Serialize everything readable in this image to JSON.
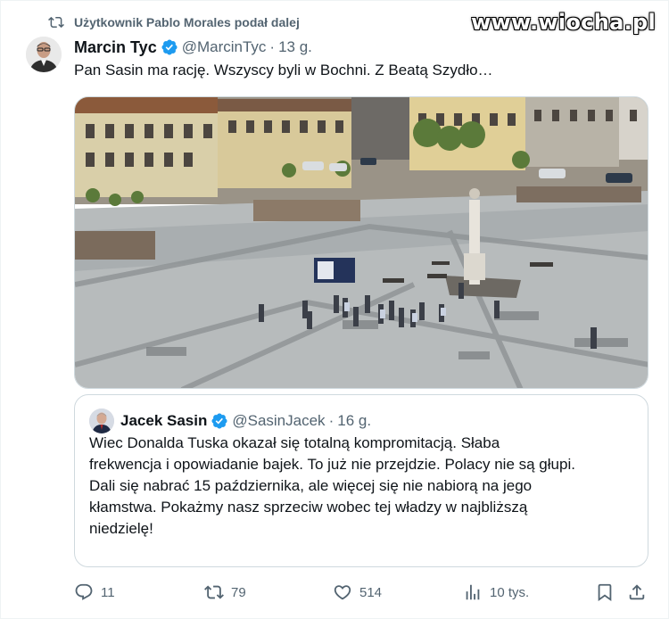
{
  "repost": {
    "label": "Użytkownik Pablo Morales podał dalej",
    "icon": "repost-icon"
  },
  "watermark": "www.wiocha.pl",
  "tweet": {
    "author_name": "Marcin Tyc",
    "author_handle": "@MarcinTyc",
    "separator": "·",
    "time": "13 g.",
    "text": "Pan Sasin ma rację. Wszyscy byli w Bochni. Z Beatą Szydło…",
    "media_icon": "town-square-photo"
  },
  "quote": {
    "author_name": "Jacek Sasin",
    "author_handle": "@SasinJacek",
    "separator": "·",
    "time": "16 g.",
    "text_lines": [
      "Wiec Donalda Tuska okazał się totalną kompromitacją. Słaba",
      "frekwencja i opowiadanie bajek. To już nie przejdzie. Polacy nie są głupi.",
      "Dali się nabrać 15 października, ale więcej się nie nabiorą na jego",
      "kłamstwa. Pokażmy nasz sprzeciw wobec tej władzy w najbliższą",
      "niedzielę!"
    ]
  },
  "actions": {
    "replies": "11",
    "reposts": "79",
    "likes": "514",
    "views": "10 tys."
  },
  "colors": {
    "text_primary": "#0f1419",
    "text_secondary": "#536471",
    "verified_blue": "#1d9bf0",
    "border": "#cfd9de"
  }
}
